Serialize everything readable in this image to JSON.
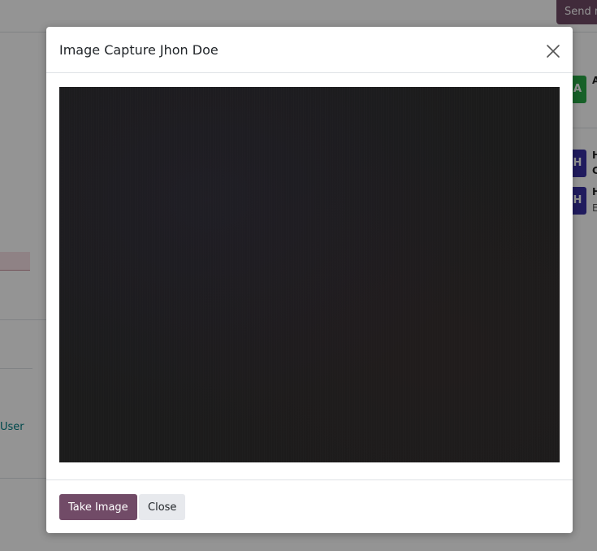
{
  "background": {
    "send_label": "Send m",
    "user_link": "User",
    "avatars": [
      {
        "letter": "A",
        "name": "A",
        "sub": ""
      },
      {
        "letter": "H",
        "name": "H",
        "sub": "C"
      },
      {
        "letter": "H",
        "name": "H",
        "sub": "E"
      }
    ],
    "colors": {
      "green": "#28a745",
      "indigo": "#3730a3",
      "primary": "#714b67"
    }
  },
  "dialog": {
    "title": "Image Capture Jhon Doe",
    "close_icon": "close-icon",
    "camera_preview": "camera-preview",
    "buttons": {
      "take_image": "Take Image",
      "close": "Close"
    }
  }
}
